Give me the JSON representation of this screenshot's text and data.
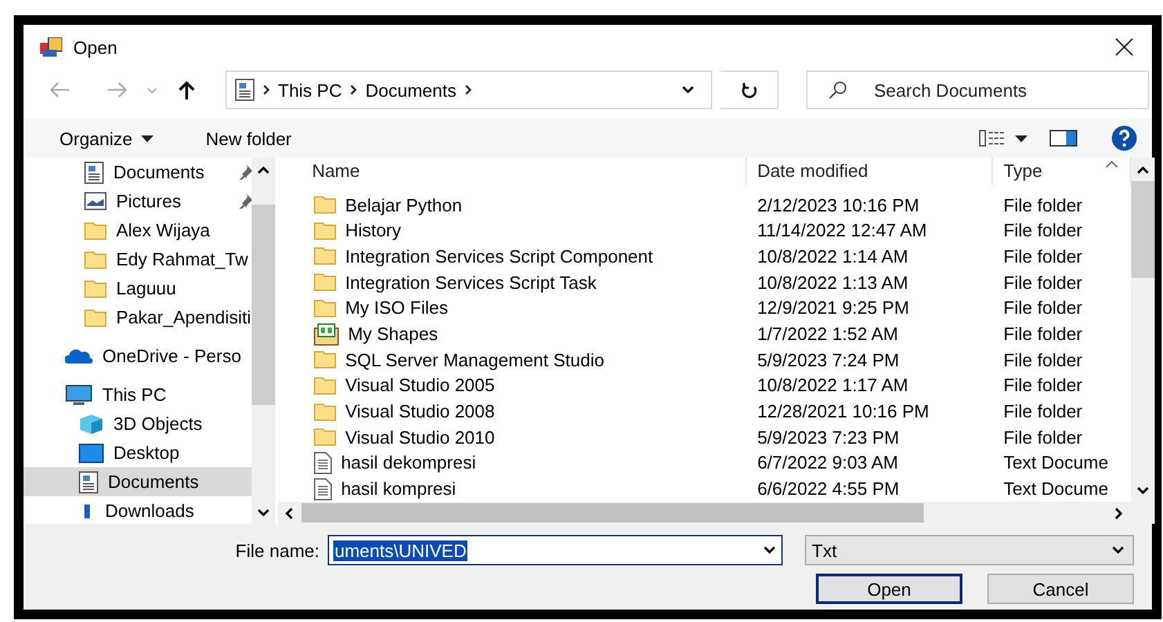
{
  "window": {
    "title": "Open"
  },
  "address": {
    "crumbs": [
      "This PC",
      "Documents"
    ]
  },
  "search": {
    "placeholder": "Search Documents"
  },
  "toolbar": {
    "organize": "Organize",
    "new_folder": "New folder"
  },
  "sidebar": {
    "quick_access_children": [
      {
        "label": "Documents",
        "kind": "documents",
        "pinned": true,
        "selected": false
      },
      {
        "label": "Pictures",
        "kind": "pictures",
        "pinned": true,
        "selected": false
      },
      {
        "label": "Alex Wijaya",
        "kind": "folder",
        "pinned": false,
        "selected": false
      },
      {
        "label": "Edy Rahmat_Tw",
        "kind": "folder",
        "pinned": false,
        "selected": false
      },
      {
        "label": "Laguuu",
        "kind": "folder",
        "pinned": false,
        "selected": false
      },
      {
        "label": "Pakar_Apendisiti",
        "kind": "folder",
        "pinned": false,
        "selected": false
      }
    ],
    "items": [
      {
        "label": "OneDrive - Perso",
        "kind": "onedrive",
        "selected": false
      },
      {
        "label": "This PC",
        "kind": "pc",
        "selected": false,
        "children": [
          {
            "label": "3D Objects",
            "kind": "objects3d",
            "selected": false
          },
          {
            "label": "Desktop",
            "kind": "desktop",
            "selected": false
          },
          {
            "label": "Documents",
            "kind": "documents",
            "selected": true
          },
          {
            "label": "Downloads",
            "kind": "downloads",
            "selected": false
          }
        ]
      }
    ]
  },
  "table": {
    "columns": [
      {
        "label": "Name",
        "sorted": false
      },
      {
        "label": "Date modified",
        "sorted": false
      },
      {
        "label": "Type",
        "sorted": true
      }
    ],
    "rows": [
      {
        "kind": "folder",
        "name": "Belajar Python",
        "date": "2/12/2023 10:16 PM",
        "type": "File folder"
      },
      {
        "kind": "folder",
        "name": "History",
        "date": "11/14/2022 12:47 AM",
        "type": "File folder"
      },
      {
        "kind": "folder",
        "name": "Integration Services Script Component",
        "date": "10/8/2022 1:14 AM",
        "type": "File folder"
      },
      {
        "kind": "folder",
        "name": "Integration Services Script Task",
        "date": "10/8/2022 1:13 AM",
        "type": "File folder"
      },
      {
        "kind": "folder",
        "name": "My ISO Files",
        "date": "12/9/2021 9:25 PM",
        "type": "File folder"
      },
      {
        "kind": "shapes",
        "name": "My Shapes",
        "date": "1/7/2022 1:52 AM",
        "type": "File folder"
      },
      {
        "kind": "folder",
        "name": "SQL Server Management Studio",
        "date": "5/9/2023 7:24 PM",
        "type": "File folder"
      },
      {
        "kind": "folder",
        "name": "Visual Studio 2005",
        "date": "10/8/2022 1:17 AM",
        "type": "File folder"
      },
      {
        "kind": "folder",
        "name": "Visual Studio 2008",
        "date": "12/28/2021 10:16 PM",
        "type": "File folder"
      },
      {
        "kind": "folder",
        "name": "Visual Studio 2010",
        "date": "5/9/2023 7:23 PM",
        "type": "File folder"
      },
      {
        "kind": "text",
        "name": "hasil dekompresi",
        "date": "6/7/2022 9:03 AM",
        "type": "Text Docume"
      },
      {
        "kind": "text",
        "name": "hasil kompresi",
        "date": "6/6/2022 4:55 PM",
        "type": "Text Docume"
      }
    ]
  },
  "footer": {
    "file_name_label": "File name:",
    "file_name_value": "uments\\UNIVED",
    "value_selected": true,
    "file_type": "Txt",
    "buttons": [
      {
        "label": "Open",
        "default": true
      },
      {
        "label": "Cancel",
        "default": false
      }
    ]
  }
}
